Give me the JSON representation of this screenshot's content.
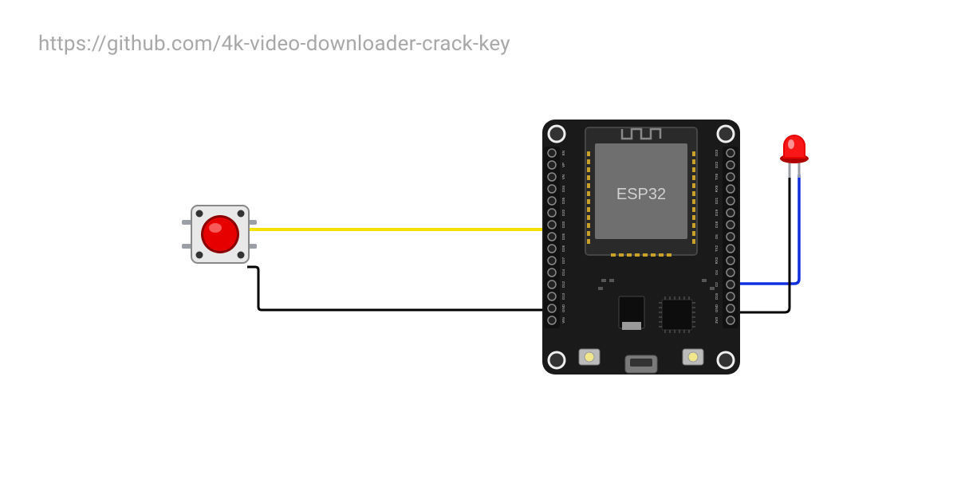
{
  "url": "https://github.com/4k-video-downloader-crack-key",
  "chip_label": "ESP32",
  "components": {
    "button": {
      "type": "tactile-pushbutton",
      "color": "red"
    },
    "board": {
      "type": "ESP32-devkit",
      "color": "black"
    },
    "led": {
      "type": "LED",
      "color": "red"
    }
  },
  "wires": [
    {
      "name": "yellow-wire",
      "from": "button.pin1",
      "to": "esp32.D33",
      "color": "#f5e100"
    },
    {
      "name": "black-wire-button",
      "from": "button.pin2",
      "to": "esp32.GND.bottom",
      "color": "#000000"
    },
    {
      "name": "blue-wire",
      "from": "led.anode",
      "to": "esp32.D2",
      "color": "#1030e0"
    },
    {
      "name": "black-wire-led",
      "from": "led.cathode",
      "to": "esp32.GND.right",
      "color": "#000000"
    }
  ],
  "pins_top": [
    "EN",
    "VP",
    "VN",
    "D34",
    "D35",
    "D32",
    "D33",
    "D25",
    "D26",
    "D27",
    "D14",
    "D12",
    "D13",
    "GND",
    "VIN"
  ],
  "pins_bottom": [
    "D23",
    "D22",
    "TX0",
    "RX0",
    "D21",
    "D19",
    "D18",
    "D5",
    "TX2",
    "RX2",
    "D4",
    "D2",
    "D15",
    "GND",
    "3V3"
  ]
}
